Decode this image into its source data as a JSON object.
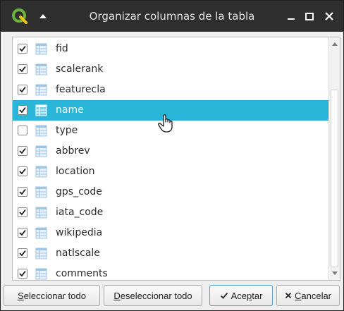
{
  "window": {
    "title": "Organizar columnas de la tabla"
  },
  "columns": [
    {
      "name": "fid",
      "checked": true,
      "selected": false
    },
    {
      "name": "scalerank",
      "checked": true,
      "selected": false
    },
    {
      "name": "featurecla",
      "checked": true,
      "selected": false
    },
    {
      "name": "name",
      "checked": true,
      "selected": true
    },
    {
      "name": "type",
      "checked": false,
      "selected": false
    },
    {
      "name": "abbrev",
      "checked": true,
      "selected": false
    },
    {
      "name": "location",
      "checked": true,
      "selected": false
    },
    {
      "name": "gps_code",
      "checked": true,
      "selected": false
    },
    {
      "name": "iata_code",
      "checked": true,
      "selected": false
    },
    {
      "name": "wikipedia",
      "checked": true,
      "selected": false
    },
    {
      "name": "natlscale",
      "checked": true,
      "selected": false
    },
    {
      "name": "comments",
      "checked": true,
      "selected": false
    }
  ],
  "buttons": {
    "select_all": {
      "underline": "S",
      "rest": "eleccionar todo"
    },
    "deselect_all": {
      "underline": "D",
      "rest": "eseleccionar todo"
    },
    "accept": {
      "prefix": "Ace",
      "underline": "p",
      "rest": "tar"
    },
    "cancel": {
      "underline": "C",
      "rest": "ancelar"
    }
  },
  "colors": {
    "selection": "#29b6d9",
    "titlebar": "#2f2f2f",
    "qgis_green": "#6ab43e"
  }
}
